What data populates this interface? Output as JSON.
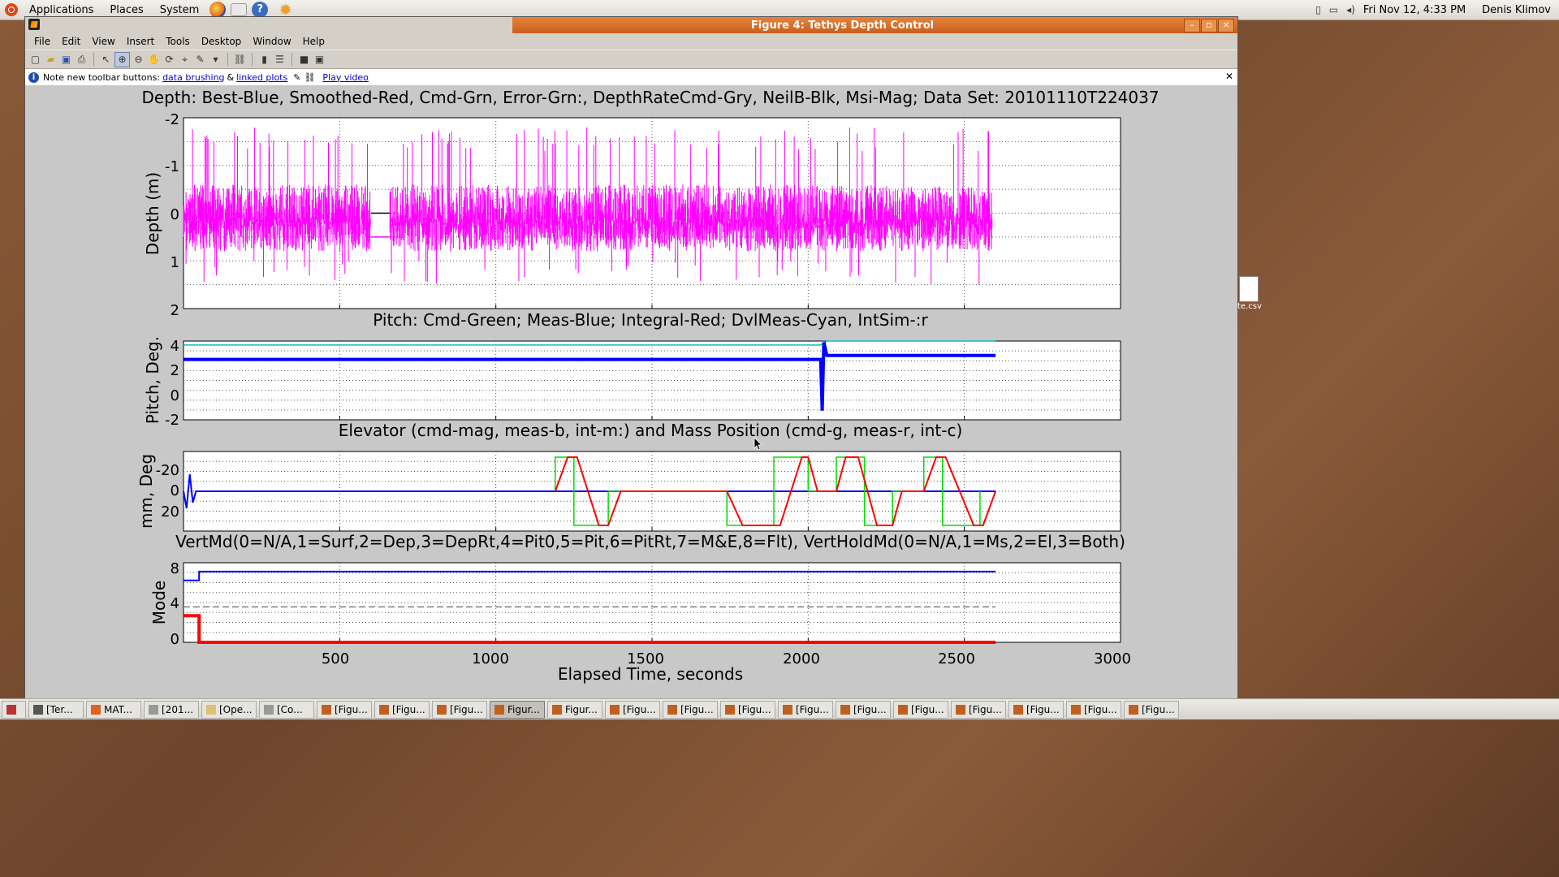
{
  "top_panel": {
    "menus": [
      "Applications",
      "Places",
      "System"
    ],
    "clock": "Fri Nov 12,  4:33 PM",
    "user": "Denis Klimov"
  },
  "window": {
    "title": "Figure 4: Tethys Depth Control",
    "controls": [
      "–",
      "▫",
      "×"
    ]
  },
  "menubar": [
    "File",
    "Edit",
    "View",
    "Insert",
    "Tools",
    "Desktop",
    "Window",
    "Help"
  ],
  "infobar": {
    "note": "Note new toolbar buttons:",
    "link1": "data brushing",
    "amp": "&",
    "link2": "linked plots",
    "video": "Play video"
  },
  "plots": {
    "xlabel": "Elapsed Time,  seconds",
    "xticks": [
      "500",
      "1000",
      "1500",
      "2000",
      "2500",
      "3000"
    ],
    "depth": {
      "title": "Depth: Best-Blue, Smoothed-Red, Cmd-Grn, Error-Grn:, DepthRateCmd-Gry, NeilB-Blk, Msi-Mag; Data Set: 20101110T224037",
      "ylabel": "Depth (m)",
      "yticks": [
        "-2",
        "-1",
        "0",
        "1",
        "2"
      ]
    },
    "pitch": {
      "title": "Pitch: Cmd-Green; Meas-Blue; Integral-Red; DvlMeas-Cyan, IntSim-:r",
      "ylabel": "Pitch, Deg.",
      "yticks": [
        "4",
        "2",
        "0",
        "-2"
      ]
    },
    "elevator": {
      "title": "Elevator (cmd-mag, meas-b, int-m:) and Mass Position (cmd-g, meas-r, int-c)",
      "ylabel": "mm, Deg",
      "yticks": [
        "-20",
        "0",
        "20"
      ]
    },
    "mode": {
      "title": "VertMd(0=N/A,1=Surf,2=Dep,3=DepRt,4=Pit0,5=Pit,6=PitRt,7=M&E,8=Flt), VertHoldMd(0=N/A,1=Ms,2=El,3=Both)",
      "ylabel": "Mode",
      "yticks": [
        "8",
        "4",
        "0"
      ]
    }
  },
  "chart_data": [
    {
      "type": "line",
      "title": "Depth: Best-Blue, Smoothed-Red, Cmd-Grn, Error-Grn:, DepthRateCmd-Gry, NeilB-Blk, Msi-Mag; Data Set: 20101110T224037",
      "ylabel": "Depth (m)",
      "xlabel": "Elapsed Time,  seconds",
      "xlim": [
        0,
        3000
      ],
      "ylim": [
        -2,
        2
      ],
      "y_reversed": true,
      "grid": true,
      "series": [
        {
          "name": "Msi-Mag",
          "color": "#ff00ff",
          "x_range": [
            0,
            2590
          ],
          "y_band": [
            -0.9,
            0.9
          ],
          "gap": [
            600,
            660
          ]
        },
        {
          "name": "NeilB-Blk",
          "color": "#000000",
          "x": [
            600,
            660
          ],
          "y": [
            0,
            0
          ]
        }
      ]
    },
    {
      "type": "line",
      "title": "Pitch: Cmd-Green; Meas-Blue; Integral-Red; DvlMeas-Cyan, IntSim-:r",
      "ylabel": "Pitch, Deg.",
      "xlim": [
        0,
        3000
      ],
      "ylim": [
        -2,
        4
      ],
      "y_reversed": false,
      "grid": true,
      "series": [
        {
          "name": "DvlMeas-Cyan",
          "color": "#00c0c0",
          "x": [
            0,
            2040,
            2060,
            2600
          ],
          "y": [
            3.7,
            3.7,
            4.0,
            4.0
          ]
        },
        {
          "name": "Meas-Blue",
          "color": "#0000ff",
          "x": [
            0,
            2040,
            2045,
            2050,
            2060,
            2600
          ],
          "y": [
            2.6,
            2.6,
            -1.3,
            3.9,
            2.9,
            2.9
          ]
        }
      ]
    },
    {
      "type": "line",
      "title": "Elevator (cmd-mag, meas-b, int-m:) and Mass Position (cmd-g, meas-r, int-c)",
      "ylabel": "mm, Deg",
      "xlim": [
        0,
        3000
      ],
      "ylim": [
        -35,
        35
      ],
      "y_reversed": true,
      "grid": true,
      "series": [
        {
          "name": "meas-b",
          "color": "#0000ff",
          "x": [
            0,
            10,
            20,
            30,
            40,
            2600
          ],
          "y": [
            0,
            15,
            -15,
            10,
            0,
            0
          ]
        },
        {
          "name": "cmd-g",
          "color": "#00dd00",
          "x": [
            1190,
            1190,
            1250,
            1250,
            1360,
            1360,
            1740,
            1740,
            1890,
            1890,
            2000,
            2000,
            2090,
            2090,
            2180,
            2180,
            2270,
            2270,
            2370,
            2370,
            2430,
            2430,
            2550,
            2550
          ],
          "y": [
            0,
            -30,
            -30,
            30,
            30,
            0,
            0,
            30,
            30,
            -30,
            -30,
            0,
            0,
            -30,
            -30,
            30,
            30,
            0,
            0,
            -30,
            -30,
            30,
            30,
            0
          ]
        },
        {
          "name": "meas-r",
          "color": "#ff0000",
          "x": [
            1190,
            1230,
            1260,
            1330,
            1360,
            1400,
            1740,
            1790,
            1910,
            1980,
            2000,
            2030,
            2090,
            2120,
            2160,
            2220,
            2270,
            2300,
            2370,
            2410,
            2440,
            2530,
            2560,
            2600
          ],
          "y": [
            0,
            -30,
            -30,
            30,
            30,
            0,
            0,
            30,
            30,
            -30,
            -30,
            0,
            0,
            -30,
            -30,
            30,
            30,
            0,
            0,
            -30,
            -30,
            30,
            30,
            0
          ]
        }
      ]
    },
    {
      "type": "line",
      "title": "VertMd(0=N/A,1=Surf,2=Dep,3=DepRt,4=Pit0,5=Pit,6=PitRt,7=M&E,8=Flt), VertHoldMd(0=N/A,1=Ms,2=El,3=Both)",
      "ylabel": "Mode",
      "xlim": [
        0,
        3000
      ],
      "ylim": [
        0,
        9
      ],
      "y_reversed": false,
      "grid": true,
      "series": [
        {
          "name": "VertMd",
          "color": "#0000ff",
          "x": [
            0,
            50,
            50,
            2600
          ],
          "y": [
            7,
            7,
            8,
            8
          ]
        },
        {
          "name": "VertHoldMd",
          "color": "#ff0000",
          "x": [
            0,
            50,
            50,
            2600
          ],
          "y": [
            3,
            3,
            0,
            0
          ]
        },
        {
          "name": "ref",
          "color": "#666666",
          "dashed": true,
          "x": [
            0,
            2600
          ],
          "y": [
            4,
            4
          ]
        }
      ]
    }
  ],
  "taskbar": [
    "[Ter...",
    "MAT...",
    "[201...",
    "[Ope...",
    "[Co...",
    "[Figu...",
    "[Figu...",
    "[Figu...",
    "Figur...",
    "Figur...",
    "[Figu...",
    "[Figu...",
    "[Figu...",
    "[Figu...",
    "[Figu...",
    "[Figu...",
    "[Figu...",
    "[Figu...",
    "[Figu...",
    "[Figu..."
  ],
  "desktop_file": "te.csv"
}
